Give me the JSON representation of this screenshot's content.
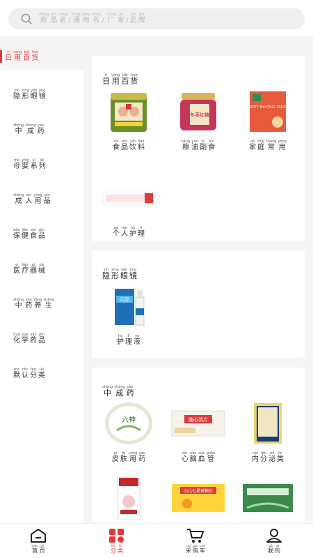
{
  "search": {
    "placeholder": [
      {
        "c": "商",
        "p": "shāng"
      },
      {
        "c": "品",
        "p": "pǐn"
      },
      {
        "c": "名",
        "p": "míng"
      },
      {
        "c": "/",
        "p": ""
      },
      {
        "c": "通",
        "p": "tōng"
      },
      {
        "c": "用",
        "p": "yòng"
      },
      {
        "c": "名",
        "p": "míng"
      },
      {
        "c": "/",
        "p": ""
      },
      {
        "c": "厂",
        "p": "chǎng"
      },
      {
        "c": "家",
        "p": "jiā"
      },
      {
        "c": "/",
        "p": ""
      },
      {
        "c": "品",
        "p": "pǐn"
      },
      {
        "c": "牌",
        "p": "pái"
      }
    ]
  },
  "sidebar": {
    "active": [
      {
        "c": "日",
        "p": "rì"
      },
      {
        "c": "用",
        "p": "yòng"
      },
      {
        "c": "百",
        "p": "bǎi"
      },
      {
        "c": "货",
        "p": "huò"
      }
    ],
    "items": [
      [
        {
          "c": "隐",
          "p": "yǐn"
        },
        {
          "c": "形",
          "p": "xíng"
        },
        {
          "c": "眼",
          "p": "yǎn"
        },
        {
          "c": "镜",
          "p": "jìng"
        }
      ],
      [
        {
          "c": "中",
          "p": "zhōng"
        },
        {
          "c": "成",
          "p": "chéng"
        },
        {
          "c": "药",
          "p": "yào"
        }
      ],
      [
        {
          "c": "母",
          "p": "mǔ"
        },
        {
          "c": "婴",
          "p": "yīng"
        },
        {
          "c": "系",
          "p": "xì"
        },
        {
          "c": "列",
          "p": "liè"
        }
      ],
      [
        {
          "c": "成",
          "p": "chéng"
        },
        {
          "c": "人",
          "p": "rén"
        },
        {
          "c": "用",
          "p": "yòng"
        },
        {
          "c": "品",
          "p": "pǐn"
        }
      ],
      [
        {
          "c": "保",
          "p": "bǎo"
        },
        {
          "c": "健",
          "p": "jiàn"
        },
        {
          "c": "食",
          "p": "shí"
        },
        {
          "c": "品",
          "p": "pǐn"
        }
      ],
      [
        {
          "c": "医",
          "p": "yī"
        },
        {
          "c": "疗",
          "p": "liáo"
        },
        {
          "c": "器",
          "p": "qì"
        },
        {
          "c": "械",
          "p": "xiè"
        }
      ],
      [
        {
          "c": "中",
          "p": "zhōng"
        },
        {
          "c": "药",
          "p": "yào"
        },
        {
          "c": "养",
          "p": "yǎng"
        },
        {
          "c": "生",
          "p": "shēng"
        }
      ],
      [
        {
          "c": "化",
          "p": "huà"
        },
        {
          "c": "学",
          "p": "xué"
        },
        {
          "c": "药",
          "p": "yào"
        },
        {
          "c": "品",
          "p": "pǐn"
        }
      ],
      [
        {
          "c": "默",
          "p": "mò"
        },
        {
          "c": "认",
          "p": "rèn"
        },
        {
          "c": "分",
          "p": "fēn"
        },
        {
          "c": "类",
          "p": "lèi"
        }
      ]
    ]
  },
  "cards": [
    {
      "title": [
        {
          "c": "日",
          "p": "rì"
        },
        {
          "c": "用",
          "p": "yòng"
        },
        {
          "c": "百",
          "p": "bǎi"
        },
        {
          "c": "货",
          "p": "huò"
        }
      ],
      "products": [
        {
          "icon": "food-drink-tin",
          "label": [
            {
              "c": "食",
              "p": "shí"
            },
            {
              "c": "品",
              "p": "pǐn"
            },
            {
              "c": "饮",
              "p": "yǐn"
            },
            {
              "c": "料",
              "p": "liào"
            }
          ]
        },
        {
          "icon": "jujube-jar",
          "label": [
            {
              "c": "粮",
              "p": "liáng"
            },
            {
              "c": "油",
              "p": "yóu"
            },
            {
              "c": "副",
              "p": "fù"
            },
            {
              "c": "食",
              "p": "shí"
            }
          ],
          "pkg": "冬枣红糖"
        },
        {
          "icon": "heating-pad-box",
          "label": [
            {
              "c": "家",
              "p": "jiā"
            },
            {
              "c": "庭",
              "p": "tíng"
            },
            {
              "c": "常",
              "p": "cháng"
            },
            {
              "c": "用",
              "p": "yòng"
            }
          ],
          "pkg": "SOFT HEATING PADS"
        },
        {
          "icon": "care-strip",
          "label": [
            {
              "c": "个",
              "p": "gè"
            },
            {
              "c": "人",
              "p": "rén"
            },
            {
              "c": "护",
              "p": "hù"
            },
            {
              "c": "理",
              "p": "lǐ"
            }
          ]
        }
      ]
    },
    {
      "title": [
        {
          "c": "隐",
          "p": "yǐn"
        },
        {
          "c": "形",
          "p": "xíng"
        },
        {
          "c": "眼",
          "p": "yǎn"
        },
        {
          "c": "镜",
          "p": "jìng"
        }
      ],
      "products": [
        {
          "icon": "care-solution-bottle",
          "label": [
            {
              "c": "护",
              "p": "hù"
            },
            {
              "c": "理",
              "p": "lǐ"
            },
            {
              "c": "液",
              "p": "yè"
            }
          ],
          "pkg": "闪亮"
        }
      ]
    },
    {
      "title": [
        {
          "c": "中",
          "p": "zhōng"
        },
        {
          "c": "成",
          "p": "chéng"
        },
        {
          "c": "药",
          "p": "yào"
        }
      ],
      "products": [
        {
          "icon": "ointment-tin",
          "label": [
            {
              "c": "皮",
              "p": "pí"
            },
            {
              "c": "肤",
              "p": "fū"
            },
            {
              "c": "用",
              "p": "yòng"
            },
            {
              "c": "药",
              "p": "yào"
            }
          ],
          "pkg": "六神"
        },
        {
          "icon": "tablet-box",
          "label": [
            {
              "c": "心",
              "p": "xīn"
            },
            {
              "c": "脑",
              "p": "nǎo"
            },
            {
              "c": "血",
              "p": "xuè"
            },
            {
              "c": "管",
              "p": "guǎn"
            }
          ],
          "pkg": "脑心清片"
        },
        {
          "icon": "herbal-box",
          "label": [
            {
              "c": "内",
              "p": "nèi"
            },
            {
              "c": "分",
              "p": "fēn"
            },
            {
              "c": "泌",
              "p": "mì"
            },
            {
              "c": "类",
              "p": "lèi"
            }
          ]
        },
        {
          "icon": "medicine-box-a",
          "label": []
        },
        {
          "icon": "medicine-box-b",
          "label": [],
          "pkg": "小儿七星茶颗粒"
        },
        {
          "icon": "medicine-box-c",
          "label": []
        }
      ]
    }
  ],
  "tabbar": [
    {
      "icon": "home-icon",
      "label": [
        {
          "c": "首",
          "p": "shǒu"
        },
        {
          "c": "页",
          "p": "yè"
        }
      ],
      "active": false
    },
    {
      "icon": "category-icon",
      "label": [
        {
          "c": "分",
          "p": "fēn"
        },
        {
          "c": "类",
          "p": "lèi"
        }
      ],
      "active": true
    },
    {
      "icon": "cart-icon",
      "label": [
        {
          "c": "采",
          "p": "cǎi"
        },
        {
          "c": "购",
          "p": "gòu"
        },
        {
          "c": "车",
          "p": "chē"
        }
      ],
      "active": false
    },
    {
      "icon": "user-icon",
      "label": [
        {
          "c": "我",
          "p": "wǒ"
        },
        {
          "c": "的",
          "p": "de"
        }
      ],
      "active": false
    }
  ],
  "colors": {
    "accent": "#e23a3a",
    "background": "#f5f5f5"
  }
}
